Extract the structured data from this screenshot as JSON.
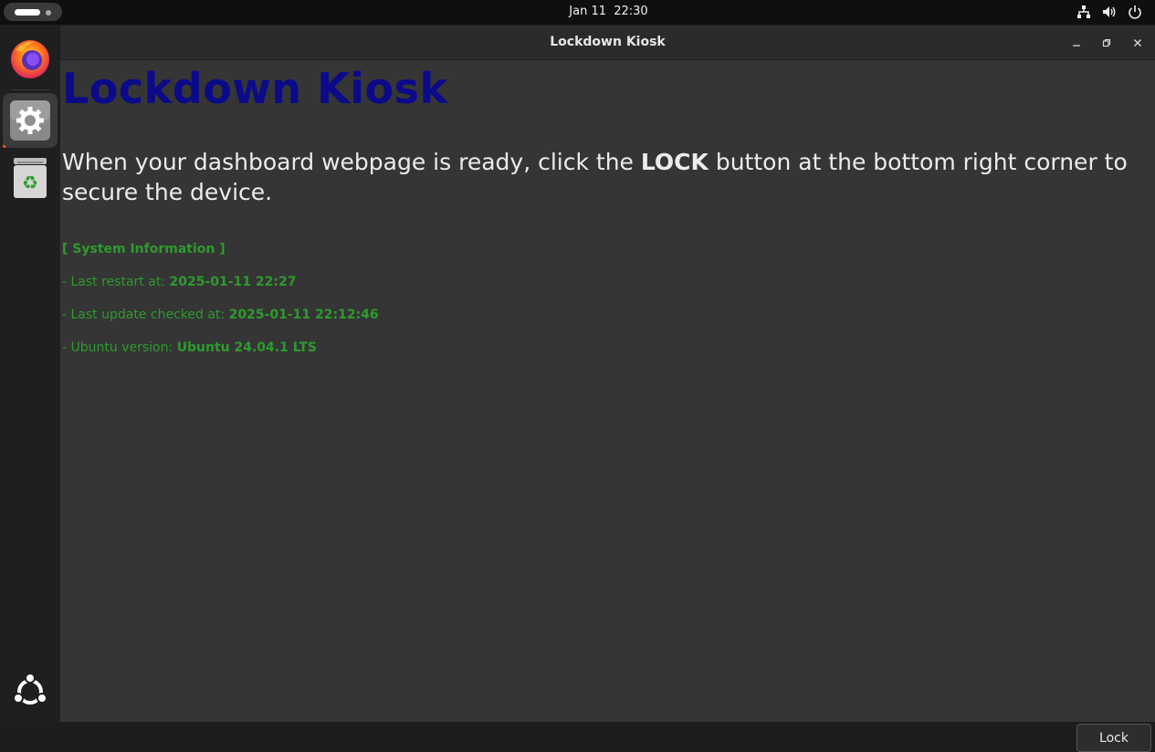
{
  "topbar": {
    "clock": "Jan 11  22:30",
    "tray_icons": [
      "network-icon",
      "volume-icon",
      "power-icon"
    ]
  },
  "dock": {
    "items": [
      "firefox-icon",
      "settings-icon",
      "trash-icon"
    ],
    "show_apps_icon": "ubuntu-logo-icon"
  },
  "window": {
    "title": "Lockdown Kiosk"
  },
  "page": {
    "heading": "Lockdown Kiosk",
    "instruction_before": "When your dashboard webpage is ready, click the ",
    "instruction_emphasis": "LOCK",
    "instruction_after": " button at the bottom right corner to secure the device.",
    "system_info_title": "[ System Information ]",
    "restart_label": "- Last restart at: ",
    "restart_value": "2025-01-11 22:27",
    "update_label": "- Last update checked at: ",
    "update_value": "2025-01-11 22:12:46",
    "version_label": "- Ubuntu version: ",
    "version_value": "Ubuntu 24.04.1 LTS",
    "lock_button": "Lock"
  },
  "colors": {
    "heading": "#0a0a8a",
    "info_text": "#2e9a2e",
    "window_bg": "#353535",
    "accent": "#e95420"
  }
}
